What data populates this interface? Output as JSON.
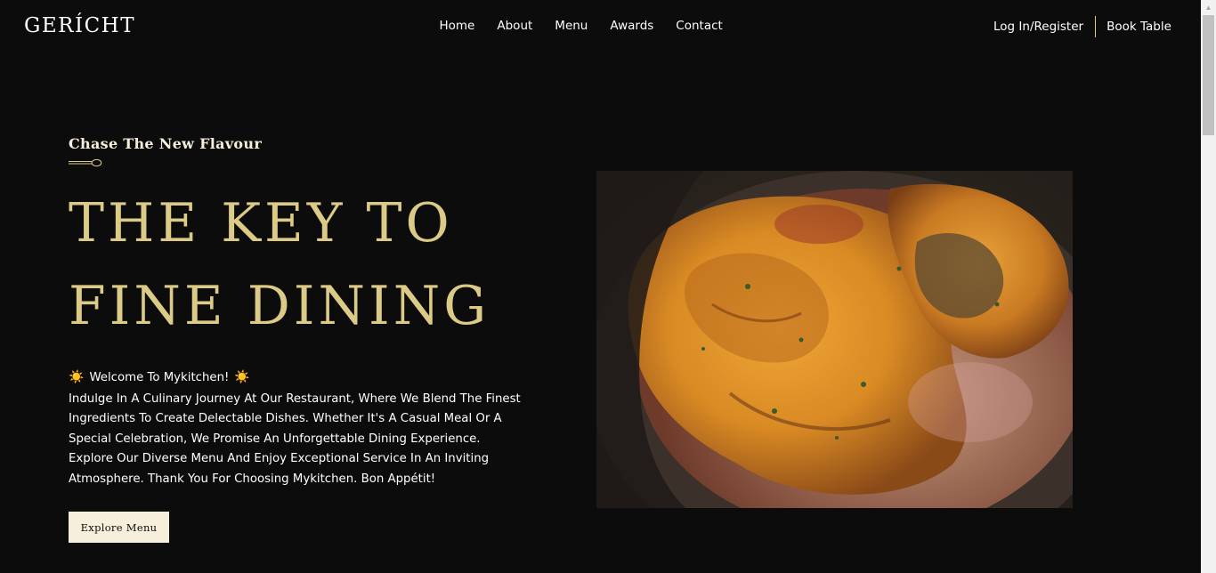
{
  "navbar": {
    "logo": "GERÍCHT",
    "links": [
      "Home",
      "About",
      "Menu",
      "Awards",
      "Contact"
    ],
    "login_label": "Log In/Register",
    "book_label": "Book Table"
  },
  "hero": {
    "subtitle": "Chase The New Flavour",
    "headline_line1": "THE KEY TO",
    "headline_line2": "FINE DINING",
    "welcome_text": "Welcome To Mykitchen!",
    "welcome_emoji": "☀️",
    "description": "Indulge In A Culinary Journey At Our Restaurant, Where We Blend The Finest Ingredients To Create Delectable Dishes. Whether It's A Casual Meal Or A Special Celebration, We Promise An Unforgettable Dining Experience. Explore Our Diverse Menu And Enjoy Exceptional Service In An Inviting Atmosphere. Thank You For Choosing Mykitchen. Bon Appétit!",
    "button_label": "Explore Menu"
  },
  "colors": {
    "background": "#0c0c0c",
    "gold": "#dcca87",
    "cream": "#f5efdb",
    "text": "#ffffff"
  },
  "icons": {
    "sun": "sun-emoji-icon",
    "spoon": "spoon-divider-icon"
  }
}
